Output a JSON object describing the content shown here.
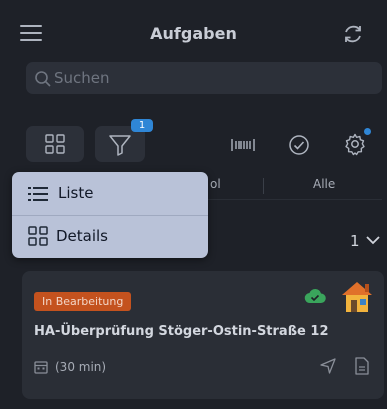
{
  "header": {
    "title": "Aufgaben",
    "menu_icon": "hamburger-menu-icon",
    "sync_icon": "sync-icon"
  },
  "search": {
    "placeholder": "Suchen",
    "value": ""
  },
  "toolbar": {
    "filter_badge": "1",
    "icons": [
      "view-grid-icon",
      "filter-icon",
      "barcode-icon",
      "check-circle-icon",
      "gear-icon"
    ]
  },
  "tabs": {
    "partial_label": "ol",
    "all_label": "Alle"
  },
  "view_menu": {
    "items": [
      {
        "label": "Liste",
        "icon": "list-icon"
      },
      {
        "label": "Details",
        "icon": "grid-icon"
      }
    ]
  },
  "list": {
    "count": "1"
  },
  "task": {
    "status": "In Bearbeitung",
    "title": "HA-Überprüfung Stöger-Ostin-Straße 12",
    "duration": "(30 min)",
    "icons": [
      "cloud-synced-icon",
      "house-icon",
      "calendar-icon",
      "navigate-icon",
      "document-icon"
    ]
  },
  "colors": {
    "background": "#1e2128",
    "surface": "#2c3039",
    "accent": "#2f86d6",
    "status_orange": "#c4521e",
    "menu_bg": "#b9c2d8",
    "cloud_green": "#3aa55c"
  }
}
